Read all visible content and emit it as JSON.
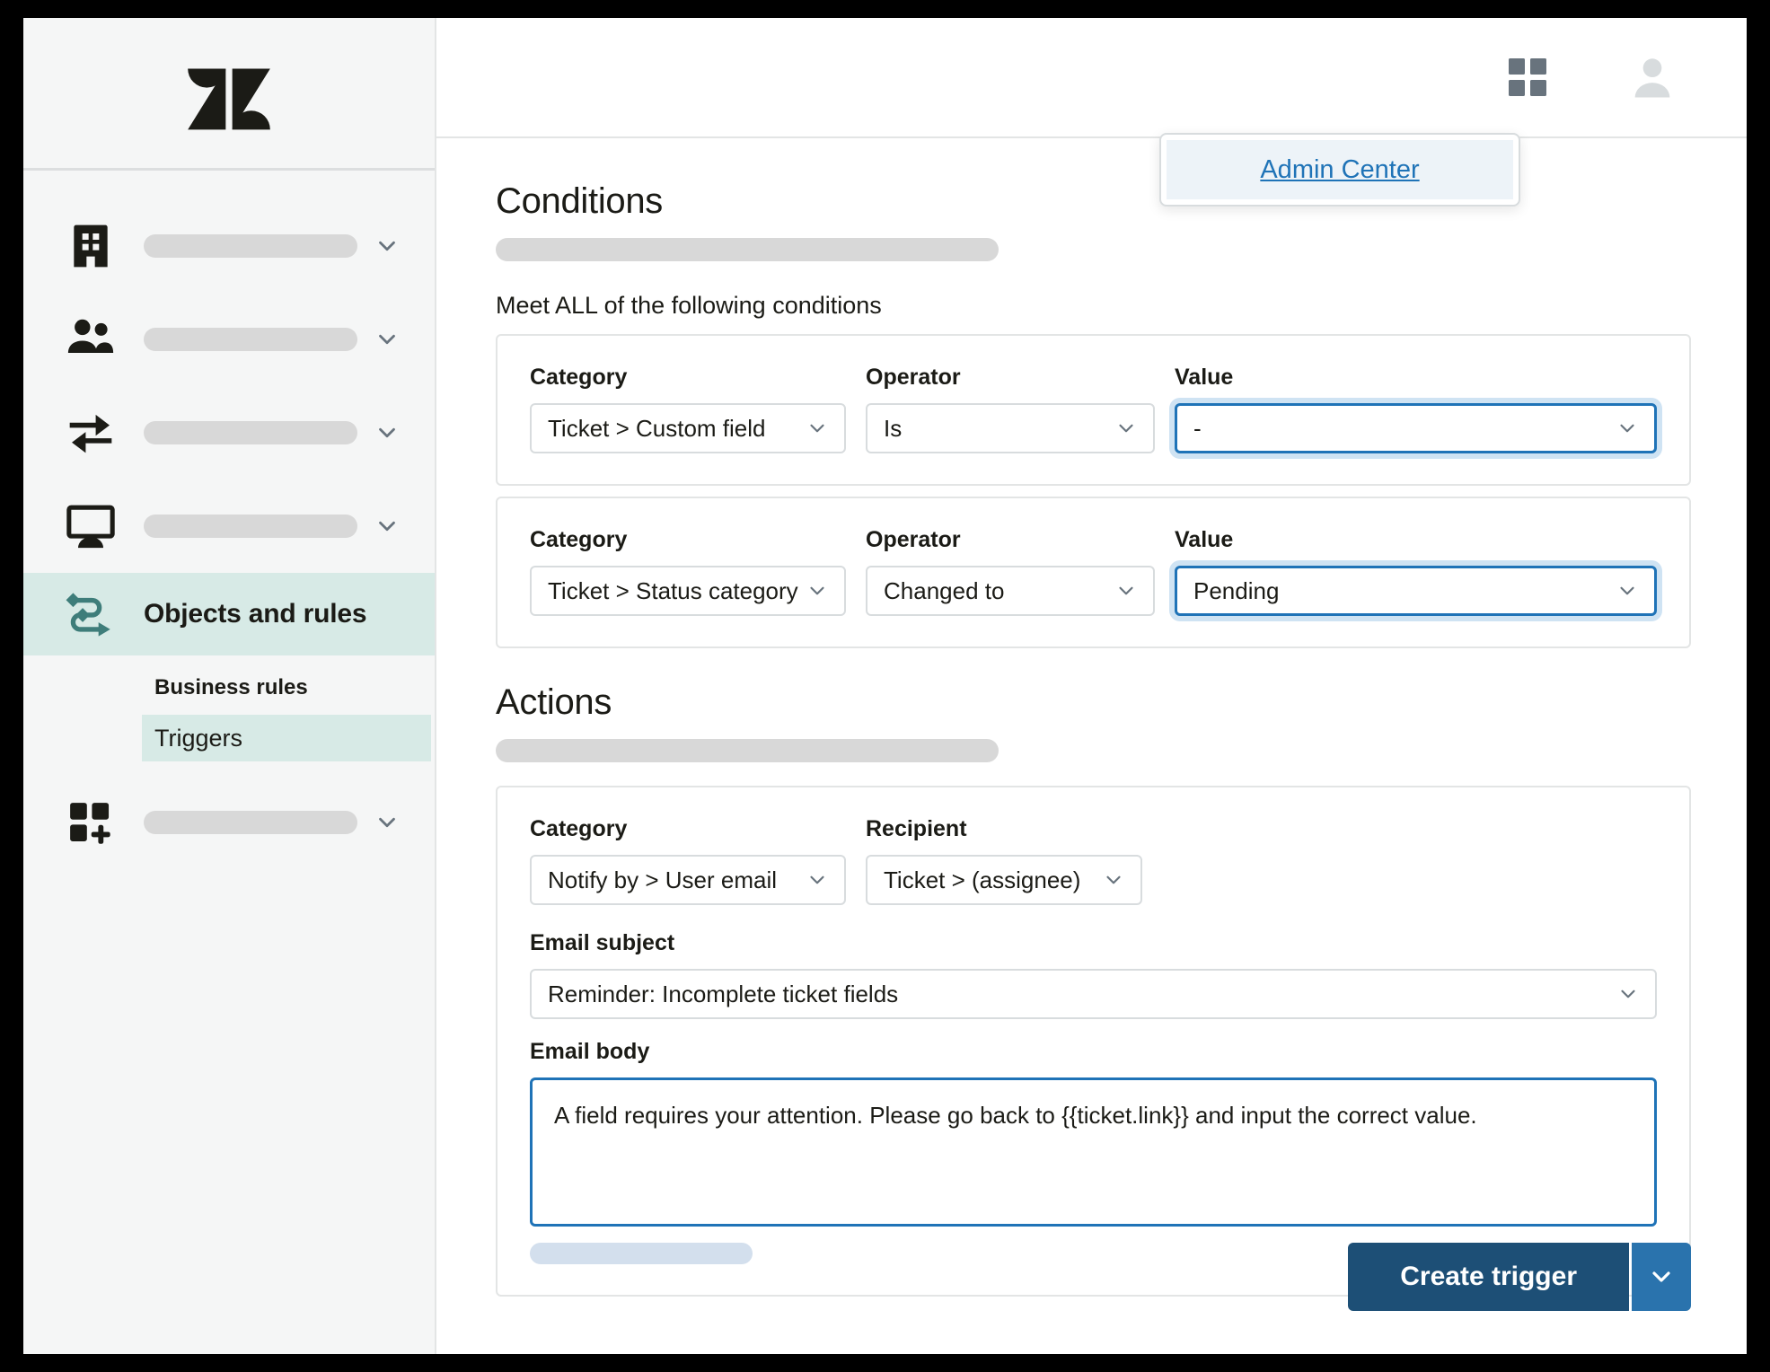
{
  "app": {
    "logo_name": "zendesk-logo"
  },
  "topbar": {
    "products_icon": "grid-icon",
    "avatar_icon": "user-avatar-icon",
    "admin_popover": {
      "link_label": "Admin Center"
    }
  },
  "sidebar": {
    "items": [
      {
        "icon": "building-icon",
        "label": "",
        "placeholder": true,
        "chevron": true
      },
      {
        "icon": "people-icon",
        "label": "",
        "placeholder": true,
        "chevron": true
      },
      {
        "icon": "arrows-exchange-icon",
        "label": "",
        "placeholder": true,
        "chevron": true
      },
      {
        "icon": "monitor-icon",
        "label": "",
        "placeholder": true,
        "chevron": true
      },
      {
        "icon": "objects-rules-icon",
        "label": "Objects and rules",
        "placeholder": false,
        "chevron": false,
        "active": true
      },
      {
        "icon": "apps-add-icon",
        "label": "",
        "placeholder": true,
        "chevron": true
      }
    ],
    "sub_heading": "Business rules",
    "sub_items": [
      {
        "label": "Triggers",
        "active": true
      }
    ],
    "active_color": "#d7eae6",
    "accent_color": "#3e7d7a"
  },
  "conditions": {
    "heading": "Conditions",
    "note": "Meet ALL of the following conditions",
    "rows": [
      {
        "category_label": "Category",
        "category_value": "Ticket > Custom field",
        "operator_label": "Operator",
        "operator_value": "Is",
        "value_label": "Value",
        "value_value": "-",
        "value_focused": true
      },
      {
        "category_label": "Category",
        "category_value": "Ticket > Status category",
        "operator_label": "Operator",
        "operator_value": "Changed to",
        "value_label": "Value",
        "value_value": "Pending",
        "value_focused": true
      }
    ]
  },
  "actions": {
    "heading": "Actions",
    "category_label": "Category",
    "category_value": "Notify by > User email",
    "recipient_label": "Recipient",
    "recipient_value": "Ticket > (assignee)",
    "subject_label": "Email subject",
    "subject_value": "Reminder: Incomplete ticket fields",
    "body_label": "Email body",
    "body_value": "A field requires your attention. Please go back to {{ticket.link}} and input the correct value."
  },
  "footer": {
    "primary_label": "Create trigger",
    "split_icon": "chevron-down-icon",
    "primary_color": "#1d4f76",
    "split_color": "#2a73ad"
  }
}
